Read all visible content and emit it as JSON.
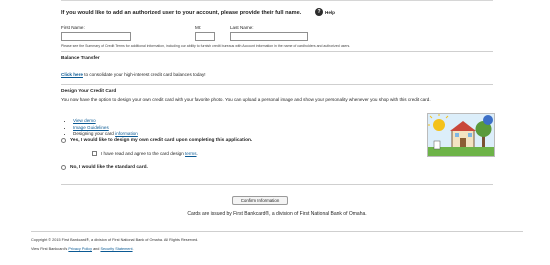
{
  "authorized_user": {
    "heading": "If you would like to add an authorized user to your account, please provide their full name.",
    "help_label": "Help",
    "first_name_label": "First Name:",
    "mi_label": "MI:",
    "last_name_label": "Last Name:",
    "first_name_value": "",
    "mi_value": "",
    "last_name_value": "",
    "disclaimer": "Please see the Summary of Credit Terms for additional information, including our ability to furnish credit bureaus with Account information in the name of cardholders and authorized users."
  },
  "balance_transfer": {
    "title": "Balance Transfer",
    "link": "Click here",
    "text": " to consolidate your high-interest credit card balances today!"
  },
  "design_card": {
    "title": "Design Your Credit Card",
    "description": "You now have the option to design your own credit card with your favorite photo. You can upload a personal image and show your personality whenever you shop with this credit card.",
    "list": {
      "view_demo": "View demo",
      "image_guidelines": "Image Guidelines",
      "designing_prefix": "Designing your card ",
      "information_link": "information"
    },
    "option_yes": "Yes, I would like to design my own credit card upon completing this application.",
    "agree_prefix": "I have read and agree to the card design ",
    "agree_link": "terms",
    "agree_suffix": ".",
    "option_no": "No, I would like the standard card."
  },
  "confirm_button": "Confirm Information",
  "issued_text": "Cards are issued by First Bankcard®, a division of First National Bank of Omaha.",
  "footer": {
    "copyright": "Copyright © 2015 First Bankcard®, a division of First National Bank of Omaha.   All Rights Reserved.",
    "view_prefix": "View First Bankcard's ",
    "privacy_link": "Privacy Policy",
    "and_text": " and ",
    "security_link": "Security Statement",
    "period": "."
  }
}
